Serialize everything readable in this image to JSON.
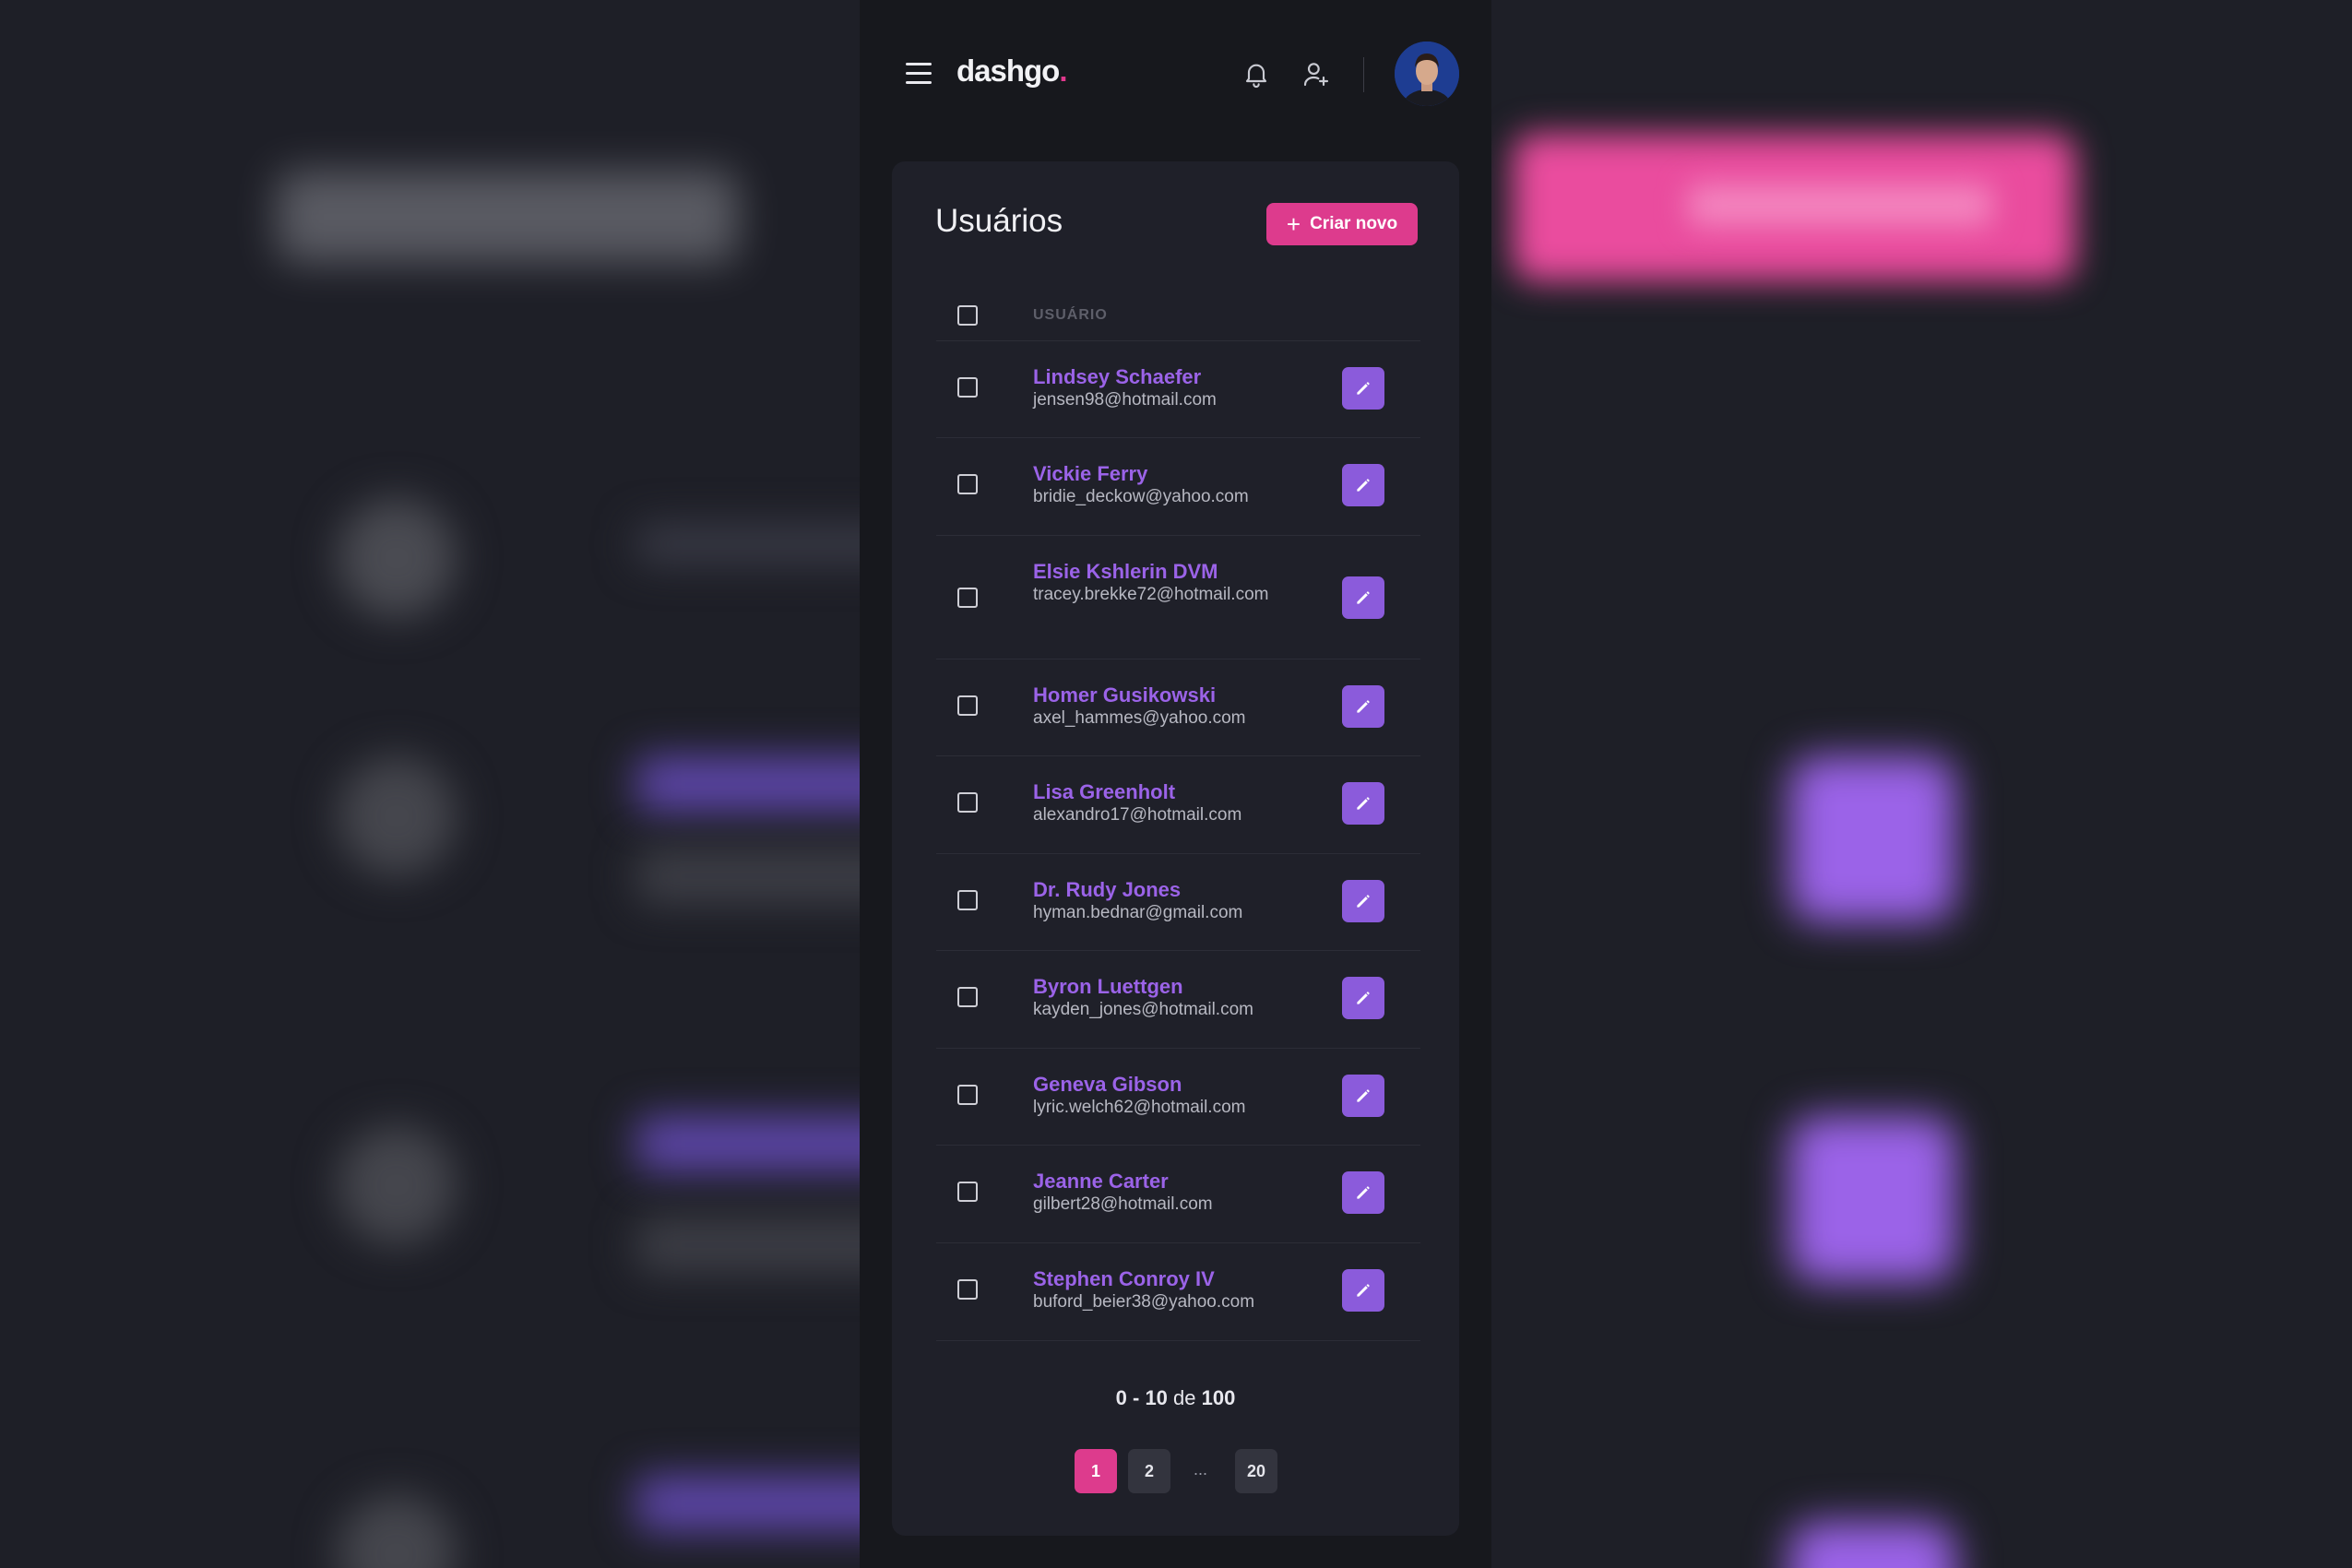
{
  "app": {
    "logo_text": "dashgo",
    "logo_dot": ".",
    "accent": "#dd3b8d",
    "purple": "#9b63e8"
  },
  "header": {
    "menu_icon": "hamburger-icon",
    "notifications_icon": "bell-icon",
    "add_user_icon": "user-plus-icon"
  },
  "page": {
    "title": "Usuários",
    "create_button": {
      "icon": "plus-icon",
      "label": "Criar novo"
    }
  },
  "table": {
    "header_label": "USUÁRIO",
    "rows": [
      {
        "name": "Lindsey Schaefer",
        "email": "jensen98@hotmail.com"
      },
      {
        "name": "Vickie Ferry",
        "email": "bridie_deckow@yahoo.com"
      },
      {
        "name": "Elsie Kshlerin DVM",
        "email": "tracey.brekke72@hotmail.com"
      },
      {
        "name": "Homer Gusikowski",
        "email": "axel_hammes@yahoo.com"
      },
      {
        "name": "Lisa Greenholt",
        "email": "alexandro17@hotmail.com"
      },
      {
        "name": "Dr. Rudy Jones",
        "email": "hyman.bednar@gmail.com"
      },
      {
        "name": "Byron Luettgen",
        "email": "kayden_jones@hotmail.com"
      },
      {
        "name": "Geneva Gibson",
        "email": "lyric.welch62@hotmail.com"
      },
      {
        "name": "Jeanne Carter",
        "email": "gilbert28@hotmail.com"
      },
      {
        "name": "Stephen Conroy IV",
        "email": "buford_beier38@yahoo.com"
      }
    ],
    "edit_icon": "pencil-icon"
  },
  "pagination": {
    "from": "0",
    "dash": "-",
    "to": "10",
    "of_label": "de",
    "total": "100",
    "pages": [
      "1",
      "2",
      "20"
    ],
    "ellipsis": "...",
    "current": "1"
  }
}
